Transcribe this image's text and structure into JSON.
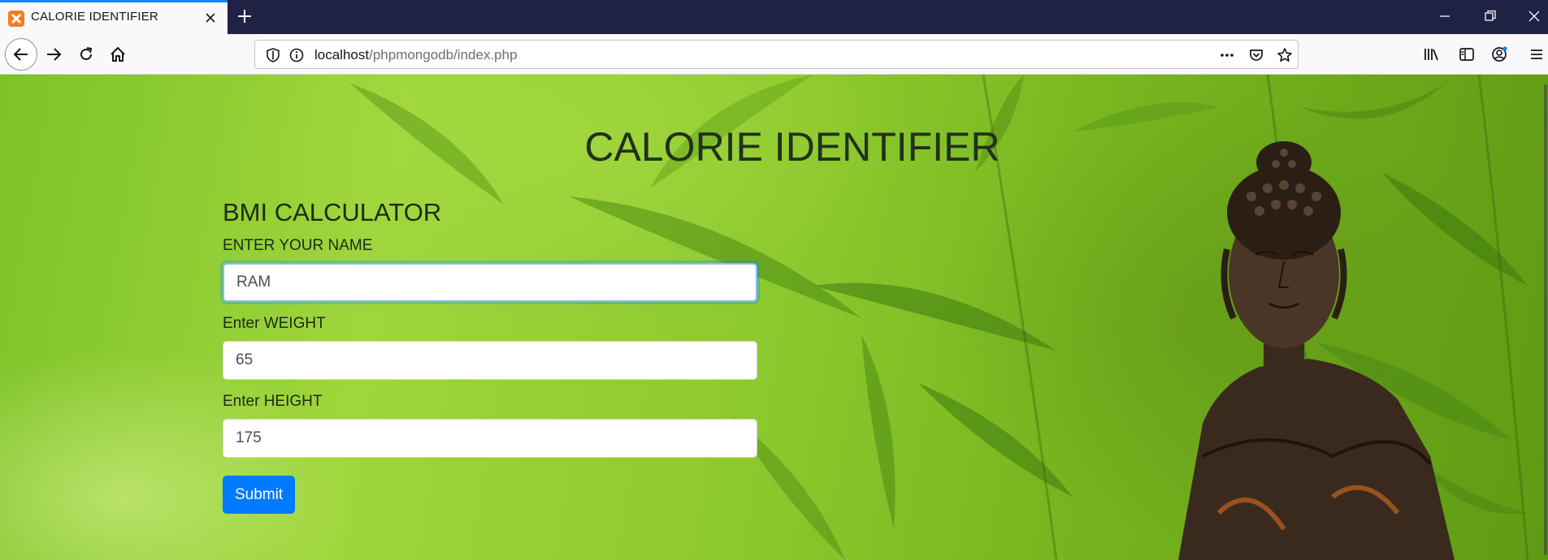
{
  "browser": {
    "tab_title": "CALORIE IDENTIFIER",
    "url_host": "localhost",
    "url_path": "/phpmongodb/index.php",
    "accent": "#0a84ff",
    "icons": [
      "xampp-favicon",
      "close-icon",
      "plus-icon",
      "minimize-icon",
      "restore-icon",
      "close-window-icon",
      "back-arrow-icon",
      "forward-arrow-icon",
      "reload-icon",
      "home-icon",
      "shield-icon",
      "info-icon",
      "more-icon",
      "pocket-icon",
      "star-icon",
      "library-icon",
      "sidebar-icon",
      "account-icon",
      "menu-icon"
    ]
  },
  "page": {
    "title": "CALORIE IDENTIFIER",
    "form": {
      "heading": "BMI CALCULATOR",
      "name_label": "ENTER YOUR NAME",
      "name_value": "RAM",
      "weight_label": "Enter WEIGHT",
      "weight_value": "65",
      "height_label": "Enter HEIGHT",
      "height_value": "175",
      "submit_label": "Submit"
    },
    "colors": {
      "submit_button": "#007bff",
      "background": "#8cc92e"
    }
  }
}
